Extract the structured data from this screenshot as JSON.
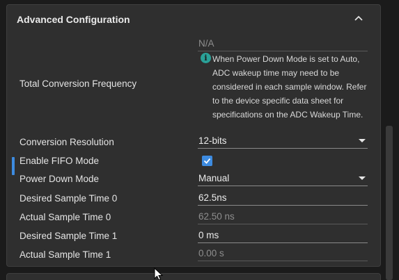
{
  "panel": {
    "title": "Advanced Configuration",
    "collapse_icon": "chevron-up-icon"
  },
  "rows": {
    "total_conversion_frequency": {
      "label": "Total Conversion Frequency",
      "value": "N/A",
      "info_icon": "info-icon",
      "info_text": "When Power Down Mode is set to Auto, ADC wakeup time may need to be considered in each sample window. Refer to the device specific data sheet for specifications on the ADC Wakeup Time."
    },
    "conversion_resolution": {
      "label": "Conversion Resolution",
      "value": "12-bits"
    },
    "enable_fifo_mode": {
      "label": "Enable FIFO Mode",
      "checked": true
    },
    "power_down_mode": {
      "label": "Power Down Mode",
      "value": "Manual"
    },
    "desired_sample_time_0": {
      "label": "Desired Sample Time 0",
      "value": "62.5ns"
    },
    "actual_sample_time_0": {
      "label": "Actual Sample Time 0",
      "value": "62.50 ns"
    },
    "desired_sample_time_1": {
      "label": "Desired Sample Time 1",
      "value": "0 ms"
    },
    "actual_sample_time_1": {
      "label": "Actual Sample Time 1",
      "value": "0.00 s"
    }
  },
  "colors": {
    "accent": "#3d8be0",
    "info": "#2aa198",
    "panel_bg": "#2f2f2f",
    "page_bg": "#1b1b1b"
  }
}
